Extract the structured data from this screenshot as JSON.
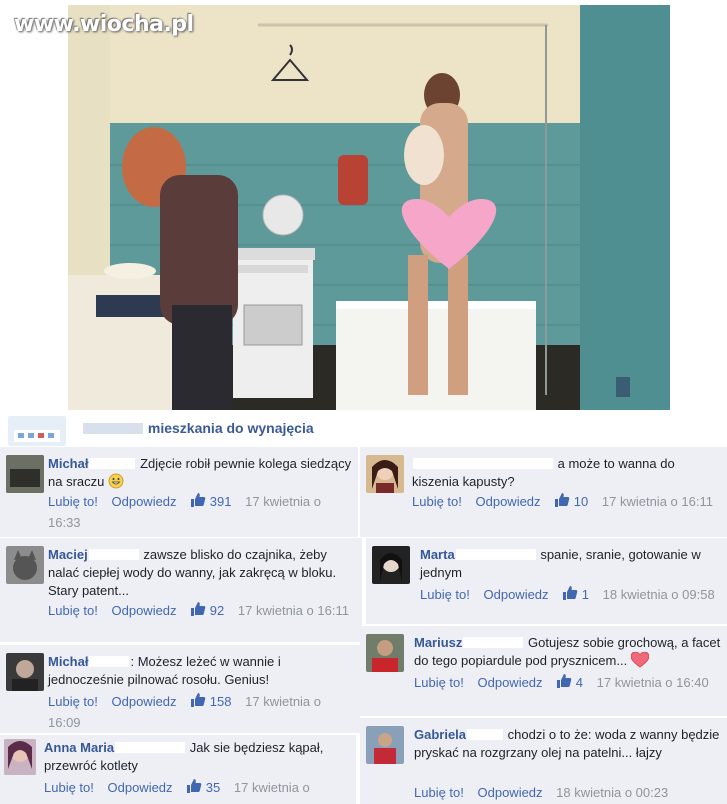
{
  "watermark": "www.wiocha.pl",
  "page": {
    "name": "mieszkania do wynajęcia"
  },
  "colors": {
    "link": "#4267b2",
    "author": "#365899",
    "meta": "#90949c",
    "comment_bg": "#edeff4"
  },
  "actions": {
    "like": "Lubię to!",
    "reply": "Odpowiedz"
  },
  "comments": [
    {
      "author": "Michał",
      "text": "Zdjęcie robił pewnie kolega siedzący na sraczu",
      "likes": "391",
      "time": "17 kwietnia o 16:33",
      "emoji": "grin-emoji"
    },
    {
      "author": "Maciej",
      "text": "zawsze blisko do czajnika, żeby nalać ciepłej wody do wanny, jak zakręcą w bloku. Stary patent...",
      "likes": "92",
      "time": "17 kwietnia o 16:11"
    },
    {
      "author": "Michał",
      "text": ": Możesz leżeć w wannie i jednocześnie pilnować rosołu. Genius!",
      "likes": "158",
      "time": "17 kwietnia o 16:09"
    },
    {
      "author": "Anna Maria",
      "text": "Jak sie będziesz kąpał, przewróć kotlety",
      "likes": "35",
      "time": "17 kwietnia o"
    },
    {
      "author": "",
      "text": "a może to wanna do kiszenia kapusty?",
      "likes": "10",
      "time": "17 kwietnia o 16:11"
    },
    {
      "author": "Marta",
      "text": "spanie, sranie, gotowanie w jednym",
      "likes": "1",
      "time": "18 kwietnia o 09:58"
    },
    {
      "author": "Mariusz",
      "text": "Gotujesz sobie grochową, a facet do tego popiardule pod prysznicem...",
      "likes": "4",
      "time": "17 kwietnia o 16:40",
      "emoji": "heart-emoji"
    },
    {
      "author": "Gabriela",
      "text": "chodzi o to że: woda z wanny będzie pryskać na rozgrzany olej na patelni... łajzy",
      "likes": "",
      "time": "18 kwietnia o 00:23"
    }
  ]
}
